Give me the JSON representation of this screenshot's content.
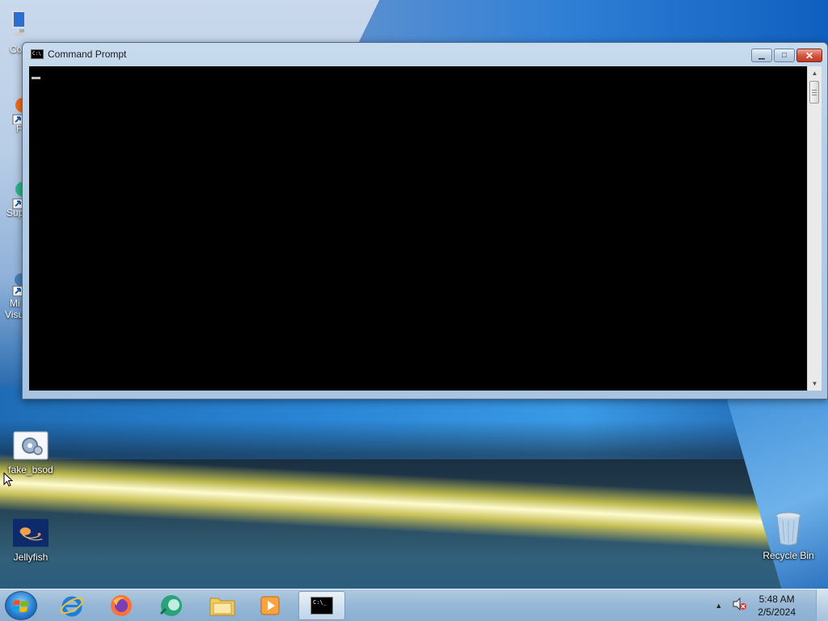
{
  "desktop": {
    "icons": [
      {
        "label": "fake_bsod",
        "icon": "settings-app-icon"
      },
      {
        "label": "Jellyfish",
        "icon": "jellyfish-image-icon"
      },
      {
        "label": "Recycle Bin",
        "icon": "recycle-bin-icon"
      }
    ],
    "partial_icons": [
      {
        "label": "Co",
        "icon": "computer-icon"
      },
      {
        "label": "F",
        "icon": "firefox-shortcut-icon"
      },
      {
        "label": "Sup",
        "icon": "support-shortcut-icon"
      },
      {
        "label": "Mi",
        "label2": "Visu",
        "icon": "visual-studio-shortcut-icon"
      }
    ]
  },
  "window": {
    "title": "Command Prompt",
    "title_icon_text": "C:\\",
    "minimize_glyph": "▁",
    "maximize_glyph": "□",
    "close_glyph": "✕",
    "console_text": ""
  },
  "taskbar": {
    "pinned": [
      {
        "name": "internet-explorer",
        "icon": "internet-explorer-icon"
      },
      {
        "name": "firefox",
        "icon": "firefox-icon"
      },
      {
        "name": "app-green",
        "icon": "green-app-icon"
      },
      {
        "name": "file-explorer",
        "icon": "folder-icon"
      },
      {
        "name": "media-player",
        "icon": "media-player-icon"
      },
      {
        "name": "command-prompt",
        "icon": "cmd-icon",
        "text": "C:\\_"
      }
    ],
    "tray_arrow": "▲",
    "time": "5:48 AM",
    "date": "2/5/2024"
  },
  "colors": {
    "console_bg": "#000000",
    "titlebar": "#b5cde6",
    "close_button": "#c7432a"
  }
}
